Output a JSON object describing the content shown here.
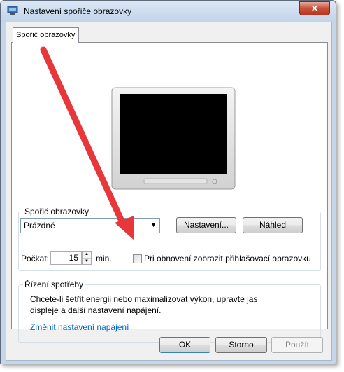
{
  "window": {
    "title": "Nastavení spořiče obrazovky",
    "close_label": "✕"
  },
  "tabs": [
    {
      "label": "Spořič obrazovky"
    }
  ],
  "screensaver_group": {
    "label": "Spořič obrazovky",
    "selected": "Prázdné",
    "settings_button": "Nastavení...",
    "preview_button": "Náhled",
    "wait_label": "Počkat:",
    "wait_value": "15",
    "minutes_label": "min.",
    "resume_checkbox_label": "Při obnovení zobrazit přihlašovací obrazovku",
    "resume_checked": false
  },
  "power_group": {
    "label": "Řízení spotřeby",
    "description_line1": "Chcete-li šetřit energii nebo maximalizovat výkon, upravte jas",
    "description_line2": "displeje a další nastavení napájení.",
    "link": "Změnit nastavení napájení"
  },
  "buttons": {
    "ok": "OK",
    "cancel": "Storno",
    "apply": "Použít"
  },
  "colors": {
    "annotation_arrow": "#e8373a",
    "link": "#0066cc"
  }
}
